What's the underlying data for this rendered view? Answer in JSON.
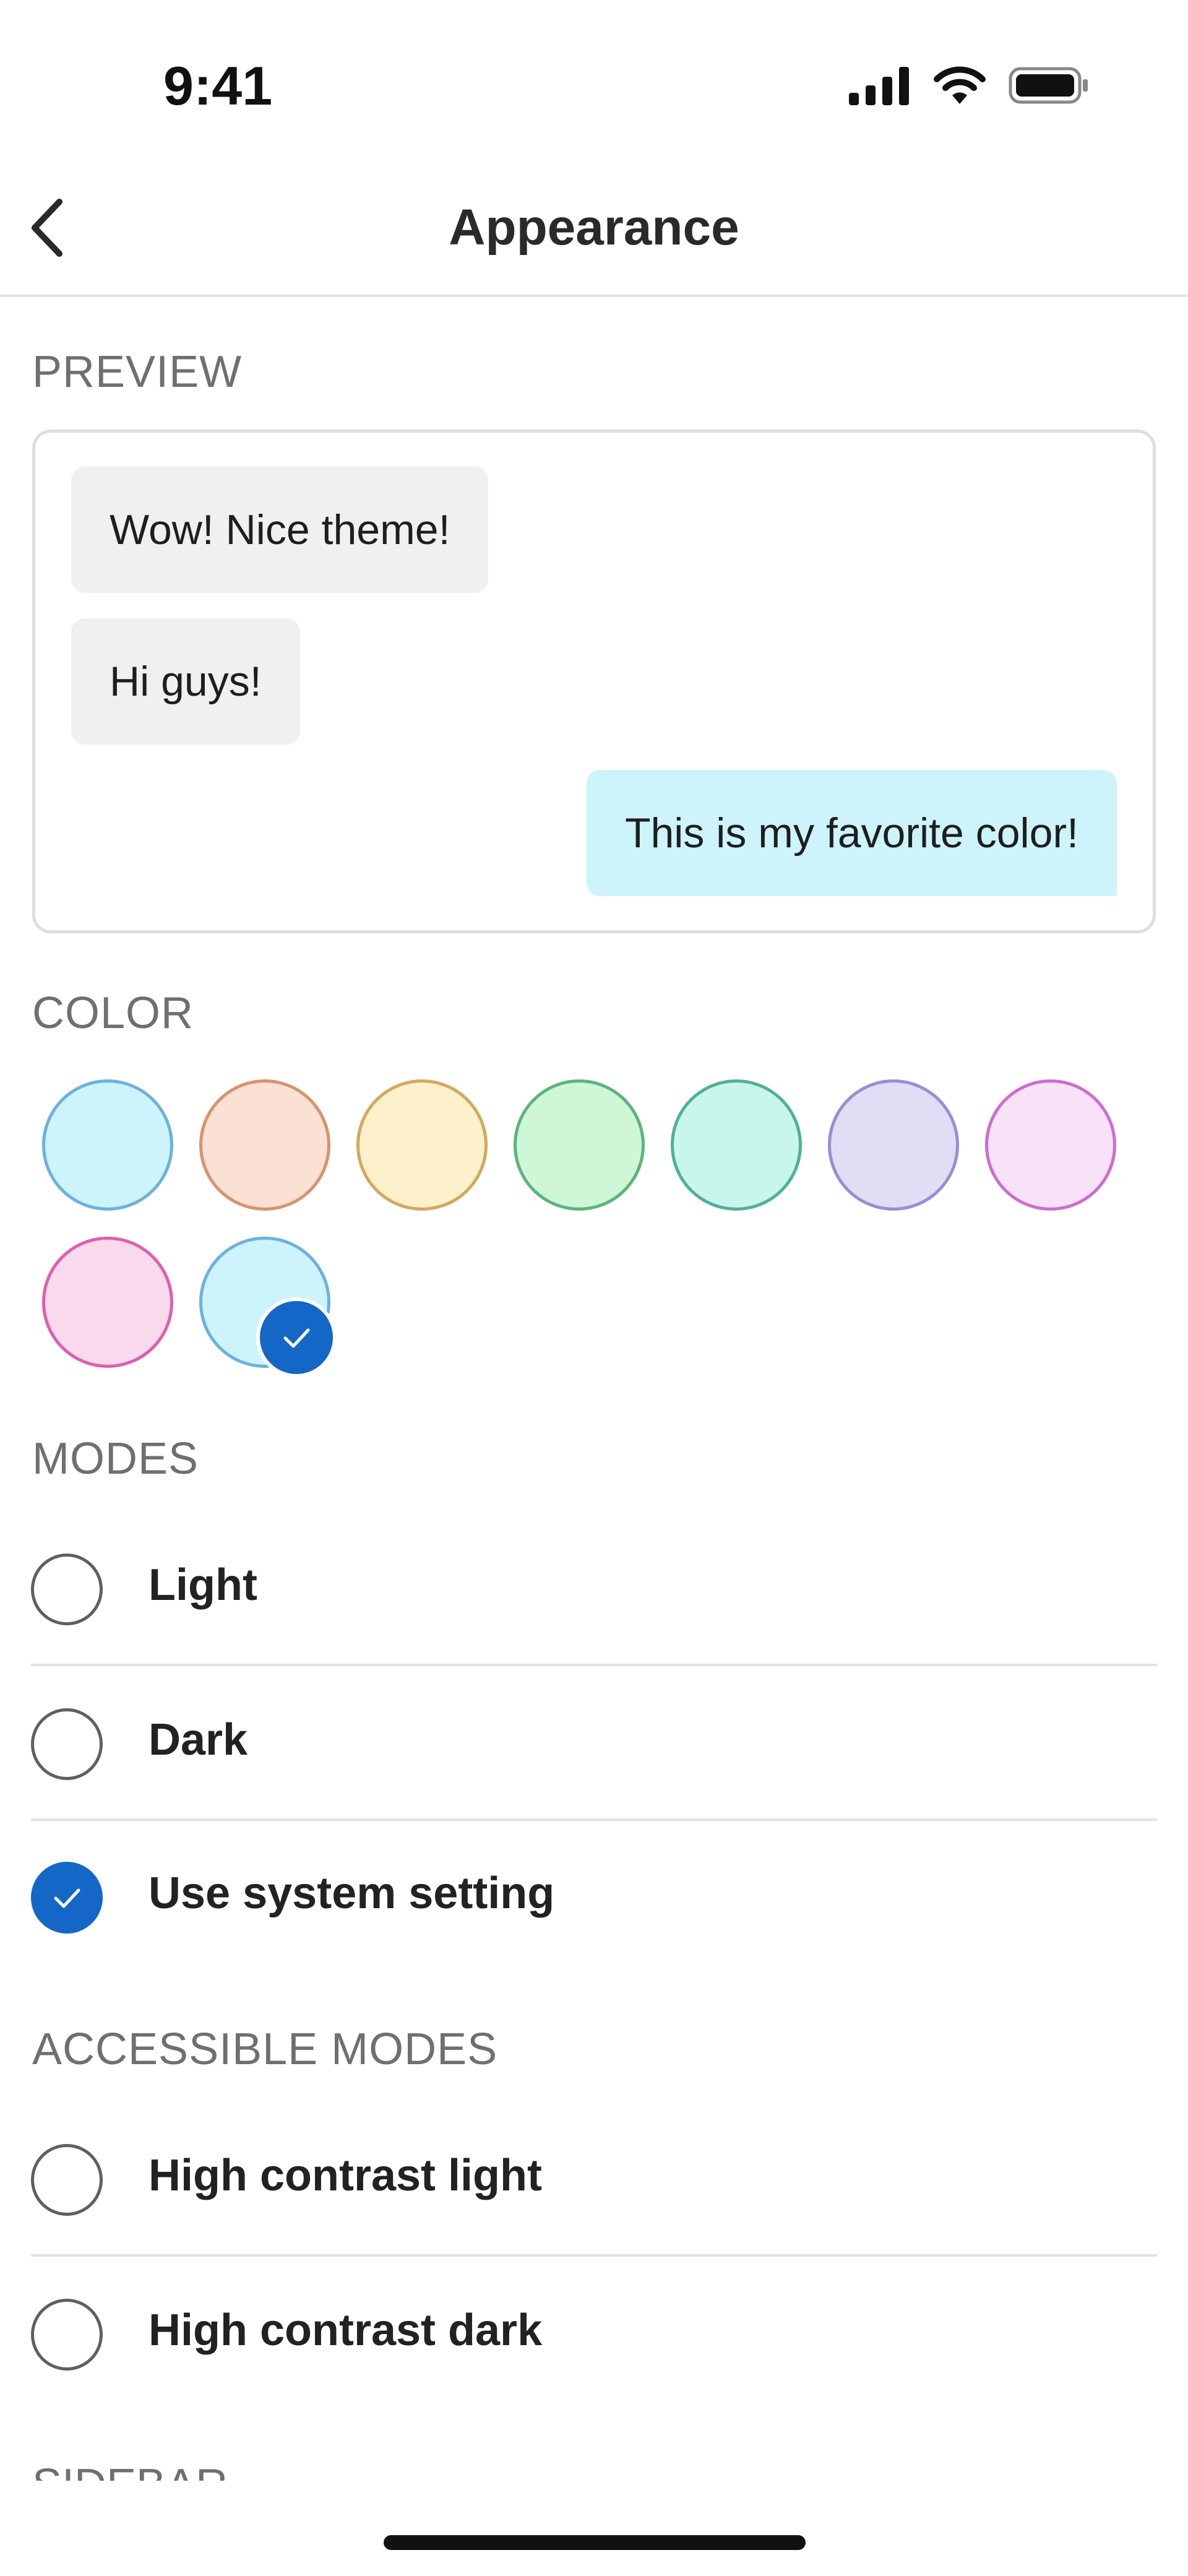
{
  "status_bar": {
    "time": "9:41"
  },
  "header": {
    "title": "Appearance"
  },
  "preview": {
    "label": "PREVIEW",
    "messages": [
      {
        "text": "Wow! Nice theme!",
        "direction": "incoming"
      },
      {
        "text": "Hi guys!",
        "direction": "incoming"
      },
      {
        "text": "This is my favorite color!",
        "direction": "outgoing"
      }
    ]
  },
  "color": {
    "label": "COLOR",
    "swatches": [
      {
        "fill": "#cdf4fb",
        "border": "#6ab2e0",
        "selected": false
      },
      {
        "fill": "#fbe0d4",
        "border": "#d9926e",
        "selected": false
      },
      {
        "fill": "#fdf1cc",
        "border": "#d4a85c",
        "selected": false
      },
      {
        "fill": "#cdf7d6",
        "border": "#5cb47c",
        "selected": false
      },
      {
        "fill": "#c8f5ec",
        "border": "#4fb196",
        "selected": false
      },
      {
        "fill": "#e1ddf4",
        "border": "#9590d4",
        "selected": false
      },
      {
        "fill": "#f7e2f8",
        "border": "#cf6ccf",
        "selected": false
      },
      {
        "fill": "#f9d9ec",
        "border": "#de5fae",
        "selected": false
      },
      {
        "fill": "#cdf4fb",
        "border": "#6ab2e0",
        "selected": true
      }
    ]
  },
  "modes": {
    "label": "MODES",
    "options": [
      {
        "label": "Light",
        "selected": false
      },
      {
        "label": "Dark",
        "selected": false
      },
      {
        "label": "Use system setting",
        "selected": true
      }
    ]
  },
  "accessible_modes": {
    "label": "ACCESSIBLE MODES",
    "options": [
      {
        "label": "High contrast light",
        "selected": false
      },
      {
        "label": "High contrast dark",
        "selected": false
      }
    ]
  },
  "next_section": {
    "label": "SIDEBAR"
  },
  "colors": {
    "accent": "#1467c7",
    "outgoing_bubble": "#cdf4fb",
    "incoming_bubble": "#f0f0f0"
  }
}
